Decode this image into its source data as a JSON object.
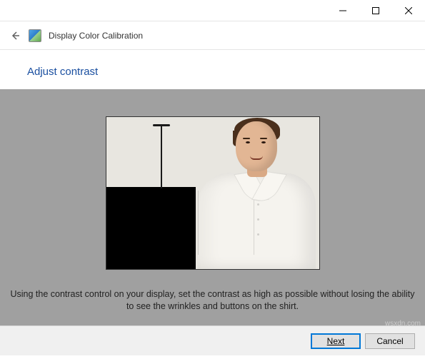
{
  "window": {
    "title": "Display Color Calibration"
  },
  "page": {
    "heading": "Adjust contrast",
    "instruction": "Using the contrast control on your display, set the contrast as high as possible without losing the ability to see the wrinkles and buttons on the shirt."
  },
  "buttons": {
    "next": "Next",
    "cancel": "Cancel"
  },
  "watermark": "wsxdn.com"
}
